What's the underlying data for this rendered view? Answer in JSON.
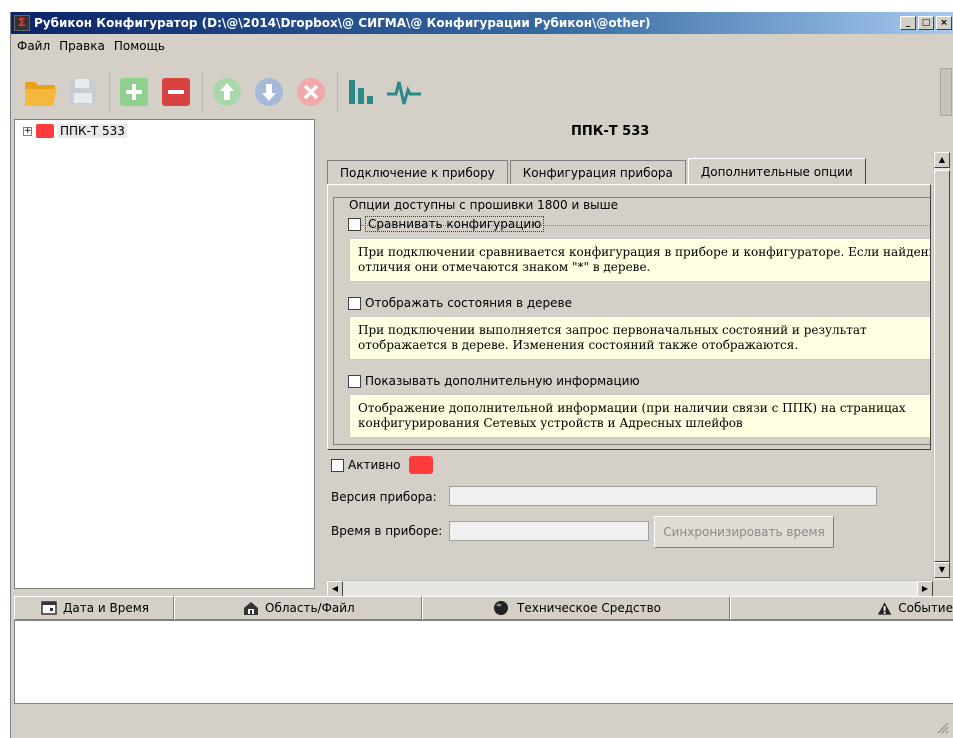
{
  "window": {
    "title": "Рубикон Конфигуратор (D:\\@\\2014\\Dropbox\\@ СИГМА\\@ Конфигурации Рубикон\\@other)",
    "app_icon": "Σ",
    "minimize": "_",
    "maximize": "□",
    "close": "×"
  },
  "menu": {
    "items": [
      "Файл",
      "Правка",
      "Помощь"
    ]
  },
  "toolbar": {
    "icons": [
      "open-folder-icon",
      "save-icon",
      "add-icon",
      "remove-icon",
      "move-up-icon",
      "move-down-icon",
      "cancel-icon",
      "bar-chart-icon",
      "pulse-icon"
    ],
    "colors": {
      "folder": "#f5a623",
      "add": "#7ec97e",
      "remove": "#e04848",
      "arrows": "#9acf9a",
      "cancel": "#f0a0a0",
      "chart": "#2a8a8a"
    }
  },
  "tree": {
    "items": [
      {
        "label": "ППК-Т 533",
        "expander": "+",
        "status_color": "#ff3b3b"
      }
    ]
  },
  "panel": {
    "title": "ППК-Т 533",
    "tabs": [
      "Подключение к прибору",
      "Конфигурация прибора",
      "Дополнительные опции"
    ],
    "active_tab": 2,
    "group_title": "Опции доступны с прошивки 1800 и выше",
    "options": [
      {
        "label": "Сравнивать конфигурацию",
        "checked": false,
        "note_line1": "При подключении сравнивается конфигурация в приборе и конфигураторе. Если найдены",
        "note_line2": "отличия они отмечаются знаком \"*\" в дереве."
      },
      {
        "label": "Отображать состояния в дереве",
        "checked": false,
        "note_line1": "При подключении выполняется запрос первоначальных состояний и результат",
        "note_line2": "отображается в дереве. Изменения состояний также отображаются."
      },
      {
        "label": "Показывать дополнительную информацию",
        "checked": false,
        "note_line1": "Отображение дополнительной информации (при наличии связи с ППК) на страницах",
        "note_line2": "конфигурирования Сетевых устройств и Адресных шлейфов"
      }
    ],
    "active_label": "Активно",
    "active_color": "#ff3b3b",
    "version_label": "Версия прибора:",
    "version_value": "",
    "time_label": "Время в приборе:",
    "time_value": "",
    "sync_button": "Синхронизировать время"
  },
  "log": {
    "columns": [
      {
        "label": "Дата и Время",
        "icon": "calendar-icon"
      },
      {
        "label": "Область/Файл",
        "icon": "house-icon"
      },
      {
        "label": "Техническое Средство",
        "icon": "device-icon"
      },
      {
        "label": "Событие",
        "icon": "warning-icon"
      }
    ]
  }
}
